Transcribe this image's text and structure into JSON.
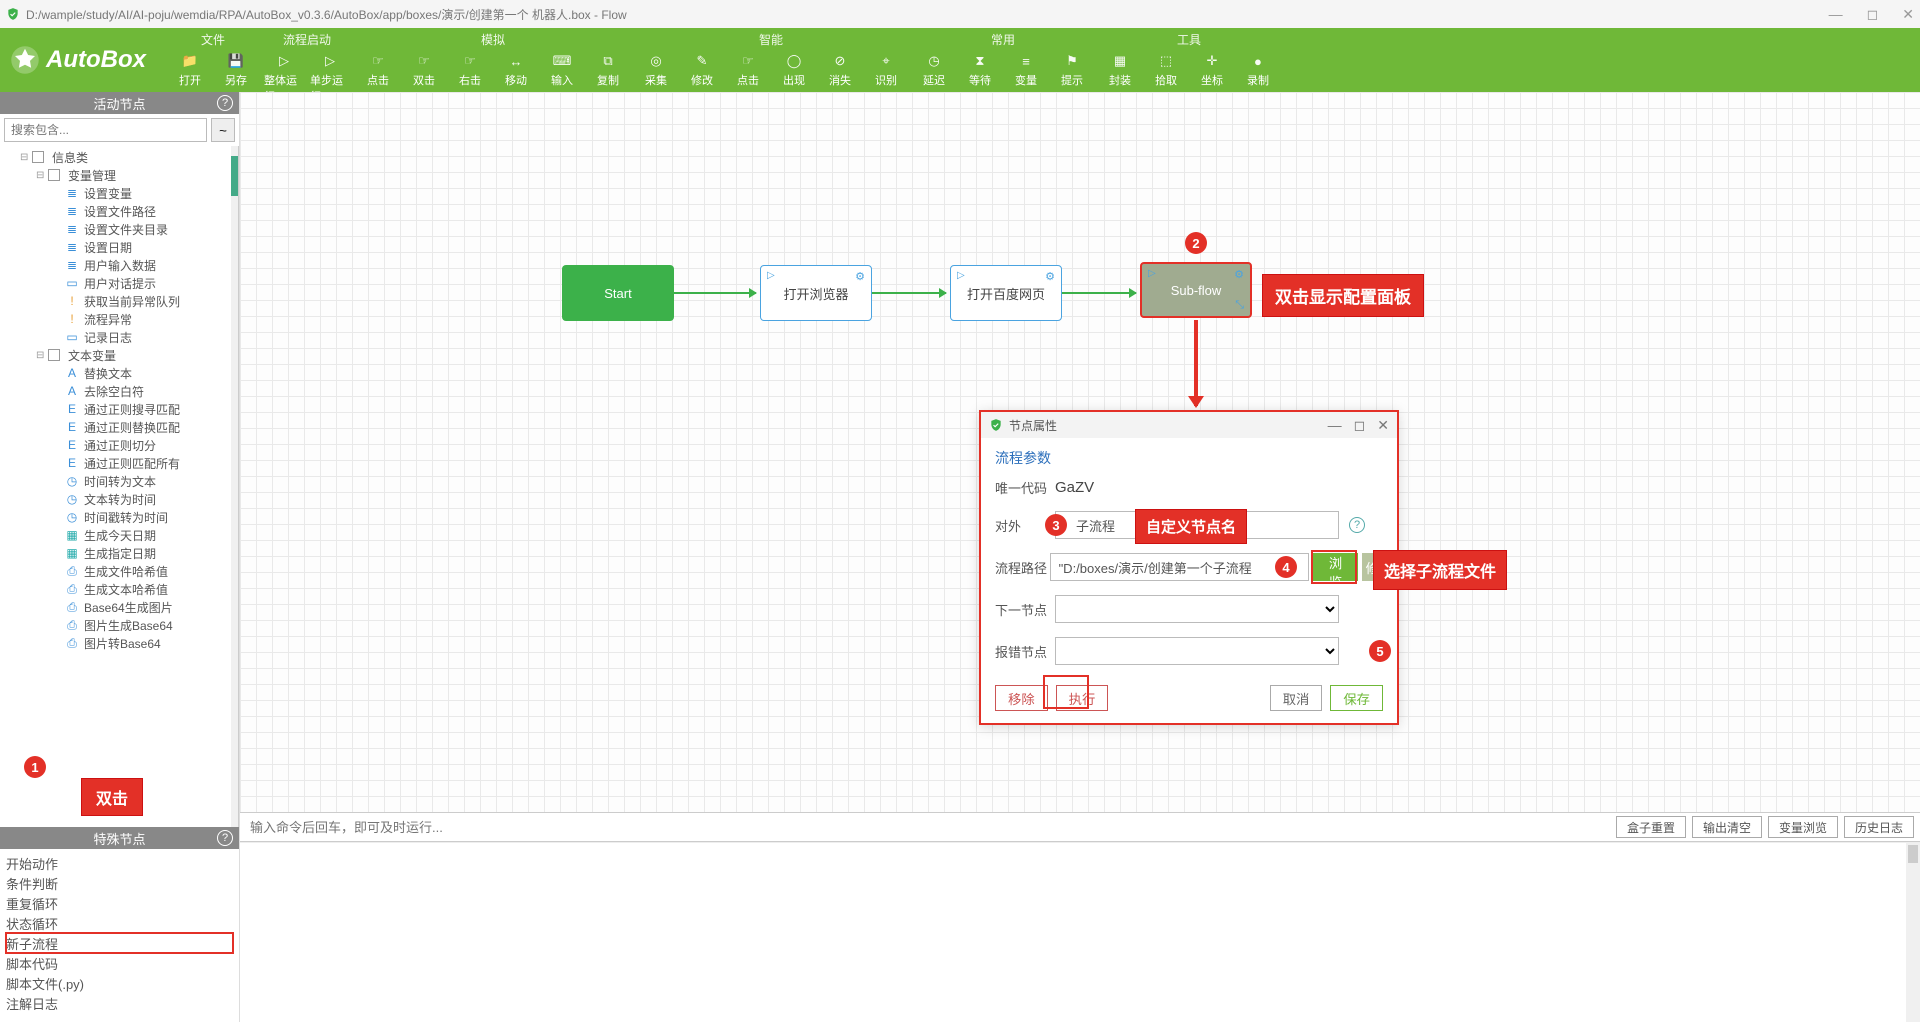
{
  "window": {
    "title": "D:/wample/study/AI/AI-poju/wemdia/RPA/AutoBox_v0.3.6/AutoBox/app/boxes/演示/创建第一个 机器人.box - Flow"
  },
  "logo_text": "AutoBox",
  "ribbon": [
    {
      "title": "文件",
      "actions": [
        {
          "label": "打开",
          "icon": "📁"
        },
        {
          "label": "另存",
          "icon": "💾"
        }
      ]
    },
    {
      "title": "流程启动",
      "actions": [
        {
          "label": "整体运行",
          "icon": "▷"
        },
        {
          "label": "单步运行",
          "icon": "▷"
        }
      ]
    },
    {
      "title": "模拟",
      "actions": [
        {
          "label": "点击",
          "icon": "☞"
        },
        {
          "label": "双击",
          "icon": "☞"
        },
        {
          "label": "右击",
          "icon": "☞"
        },
        {
          "label": "移动",
          "icon": "↔"
        },
        {
          "label": "输入",
          "icon": "⌨"
        },
        {
          "label": "复制",
          "icon": "⧉"
        }
      ]
    },
    {
      "title": "智能",
      "actions": [
        {
          "label": "采集",
          "icon": "◎"
        },
        {
          "label": "修改",
          "icon": "✎"
        },
        {
          "label": "点击",
          "icon": "☞"
        },
        {
          "label": "出现",
          "icon": "◯"
        },
        {
          "label": "消失",
          "icon": "⊘"
        },
        {
          "label": "识别",
          "icon": "⌖"
        }
      ]
    },
    {
      "title": "常用",
      "actions": [
        {
          "label": "延迟",
          "icon": "◷"
        },
        {
          "label": "等待",
          "icon": "⧗"
        },
        {
          "label": "变量",
          "icon": "≡"
        },
        {
          "label": "提示",
          "icon": "⚑"
        }
      ]
    },
    {
      "title": "工具",
      "actions": [
        {
          "label": "封装",
          "icon": "▦"
        },
        {
          "label": "拾取",
          "icon": "⬚"
        },
        {
          "label": "坐标",
          "icon": "✛"
        },
        {
          "label": "录制",
          "icon": "●"
        }
      ]
    }
  ],
  "panels": {
    "activity_title": "活动节点",
    "special_title": "特殊节点",
    "search_placeholder": "搜索包含...",
    "tilde": "~"
  },
  "tree": [
    {
      "lvl": 1,
      "exp": "⊟",
      "chk": true,
      "label": "信息类"
    },
    {
      "lvl": 2,
      "exp": "⊟",
      "chk": true,
      "label": "变量管理"
    },
    {
      "lvl": 3,
      "ic": "≣",
      "cls": "",
      "label": "设置变量"
    },
    {
      "lvl": 3,
      "ic": "≣",
      "cls": "",
      "label": "设置文件路径"
    },
    {
      "lvl": 3,
      "ic": "≣",
      "cls": "",
      "label": "设置文件夹目录"
    },
    {
      "lvl": 3,
      "ic": "≣",
      "cls": "",
      "label": "设置日期"
    },
    {
      "lvl": 3,
      "ic": "≣",
      "cls": "",
      "label": "用户输入数据"
    },
    {
      "lvl": 3,
      "ic": "▭",
      "cls": "",
      "label": "用户对话提示"
    },
    {
      "lvl": 3,
      "ic": "!",
      "cls": "orange",
      "label": "获取当前异常队列"
    },
    {
      "lvl": 3,
      "ic": "!",
      "cls": "orange",
      "label": "流程异常"
    },
    {
      "lvl": 3,
      "ic": "▭",
      "cls": "",
      "label": "记录日志"
    },
    {
      "lvl": 2,
      "exp": "⊟",
      "chk": true,
      "label": "文本变量"
    },
    {
      "lvl": 3,
      "ic": "A",
      "cls": "",
      "label": "替换文本"
    },
    {
      "lvl": 3,
      "ic": "A",
      "cls": "",
      "label": "去除空白符"
    },
    {
      "lvl": 3,
      "ic": "E",
      "cls": "",
      "label": "通过正则搜寻匹配"
    },
    {
      "lvl": 3,
      "ic": "E",
      "cls": "",
      "label": "通过正则替换匹配"
    },
    {
      "lvl": 3,
      "ic": "E",
      "cls": "",
      "label": "通过正则切分"
    },
    {
      "lvl": 3,
      "ic": "E",
      "cls": "",
      "label": "通过正则匹配所有"
    },
    {
      "lvl": 3,
      "ic": "◷",
      "cls": "",
      "label": "时间转为文本"
    },
    {
      "lvl": 3,
      "ic": "◷",
      "cls": "",
      "label": "文本转为时间"
    },
    {
      "lvl": 3,
      "ic": "◷",
      "cls": "",
      "label": "时间戳转为时间"
    },
    {
      "lvl": 3,
      "ic": "▦",
      "cls": "teal",
      "label": "生成今天日期"
    },
    {
      "lvl": 3,
      "ic": "▦",
      "cls": "teal",
      "label": "生成指定日期"
    },
    {
      "lvl": 3,
      "ic": "⎙",
      "cls": "",
      "label": "生成文件哈希值"
    },
    {
      "lvl": 3,
      "ic": "⎙",
      "cls": "",
      "label": "生成文本哈希值"
    },
    {
      "lvl": 3,
      "ic": "⎙",
      "cls": "",
      "label": "Base64生成图片"
    },
    {
      "lvl": 3,
      "ic": "⎙",
      "cls": "",
      "label": "图片生成Base64"
    },
    {
      "lvl": 3,
      "ic": "⎙",
      "cls": "",
      "label": "图片转Base64"
    }
  ],
  "special_items": [
    "开始动作",
    "条件判断",
    "重复循环",
    "状态循环",
    "新子流程",
    "脚本代码",
    "脚本文件(.py)",
    "注解日志"
  ],
  "special_selected_index": 4,
  "flow_nodes": {
    "start": "Start",
    "n1": "打开浏览器",
    "n2": "打开百度网页",
    "sub": "Sub-flow"
  },
  "callouts": {
    "c1_text": "双击显示配置面板",
    "c2_text": "自定义节点名",
    "c3_text": "选择子流程文件",
    "dbl": "双击"
  },
  "badges": {
    "b1": "1",
    "b2": "2",
    "b3": "3",
    "b4": "4",
    "b5": "5"
  },
  "dialog": {
    "title": "节点属性",
    "section": "流程参数",
    "rows": {
      "uid_label": "唯一代码",
      "uid_value": "GaZV",
      "name_label": "对外",
      "name_value": "子流程",
      "path_label": "流程路径",
      "path_value": "\"D:/boxes/演示/创建第一个子流程",
      "next_label": "下一节点",
      "err_label": "报错节点"
    },
    "buttons": {
      "browse": "浏览",
      "mod": "修",
      "remove": "移除",
      "exec": "执行",
      "cancel": "取消",
      "save": "保存"
    }
  },
  "cmdbar": {
    "placeholder": "输入命令后回车，即可及时运行...",
    "btn_reset": "盒子重置",
    "btn_clear": "输出清空",
    "btn_vars": "变量浏览",
    "btn_hist": "历史日志"
  }
}
